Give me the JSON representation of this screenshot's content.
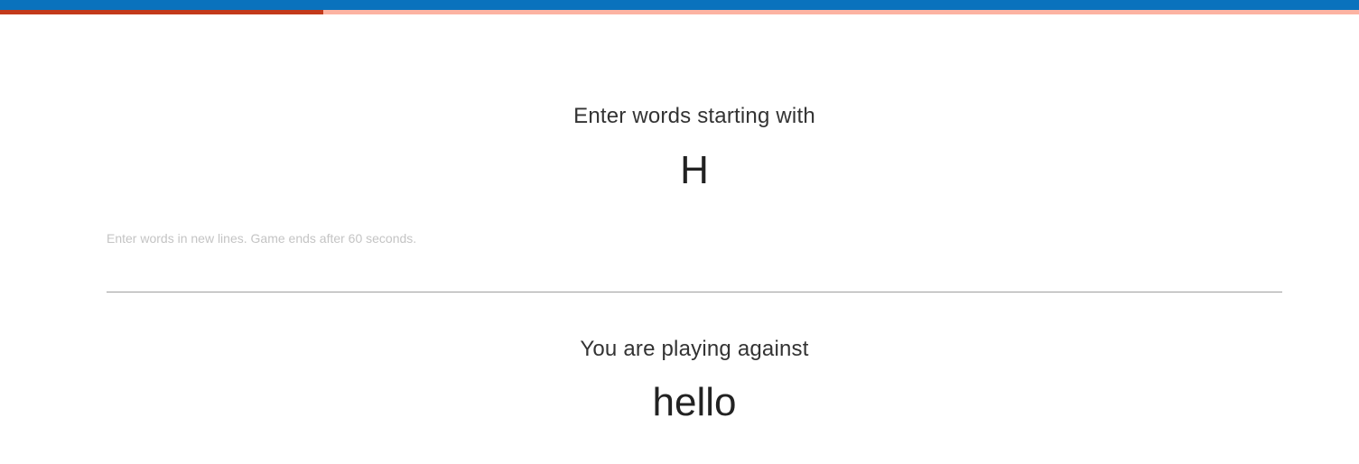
{
  "colors": {
    "header": "#0a72bd",
    "progress_fill": "#c33a1b",
    "progress_track": "#fcb3a2"
  },
  "timer": {
    "progress_fraction": 0.238
  },
  "game": {
    "prompt_label": "Enter words starting with",
    "letter": "H",
    "input_placeholder": "Enter words in new lines. Game ends after 60 seconds.",
    "input_value": "",
    "opponent_label": "You are playing against",
    "opponent_name": "hello"
  }
}
